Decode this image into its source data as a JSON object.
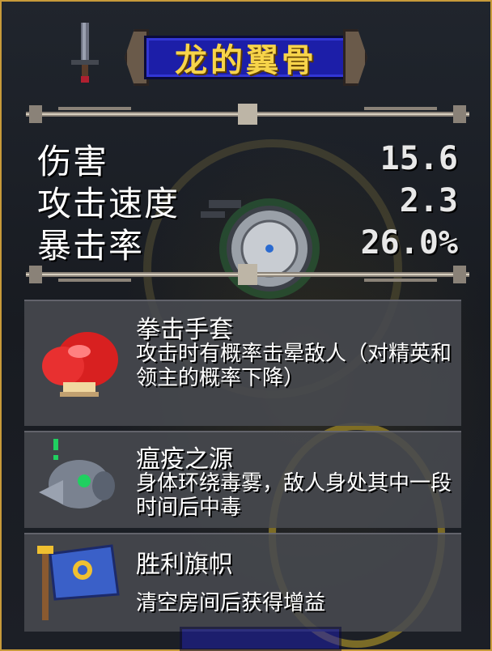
{
  "item": {
    "title": "龙的翼骨"
  },
  "stats": [
    {
      "label": "伤害",
      "value": "15.6"
    },
    {
      "label": "攻击速度",
      "value": "2.3"
    },
    {
      "label": "暴击率",
      "value": "26.0%"
    }
  ],
  "effects": [
    {
      "name": "拳击手套",
      "description": "攻击时有概率击晕敌人（对精英和领主的概率下降）",
      "icon": "boxing-glove-icon"
    },
    {
      "name": "瘟疫之源",
      "description": "身体环绕毒雾，敌人身处其中一段时间后中毒",
      "icon": "plague-mask-icon"
    },
    {
      "name": "胜利旗帜",
      "description": "清空房间后获得增益",
      "icon": "victory-flag-icon"
    }
  ],
  "colors": {
    "frame": "#c79a3a",
    "title_bg": "#1c1ea8",
    "title_text": "#f7d44a"
  }
}
